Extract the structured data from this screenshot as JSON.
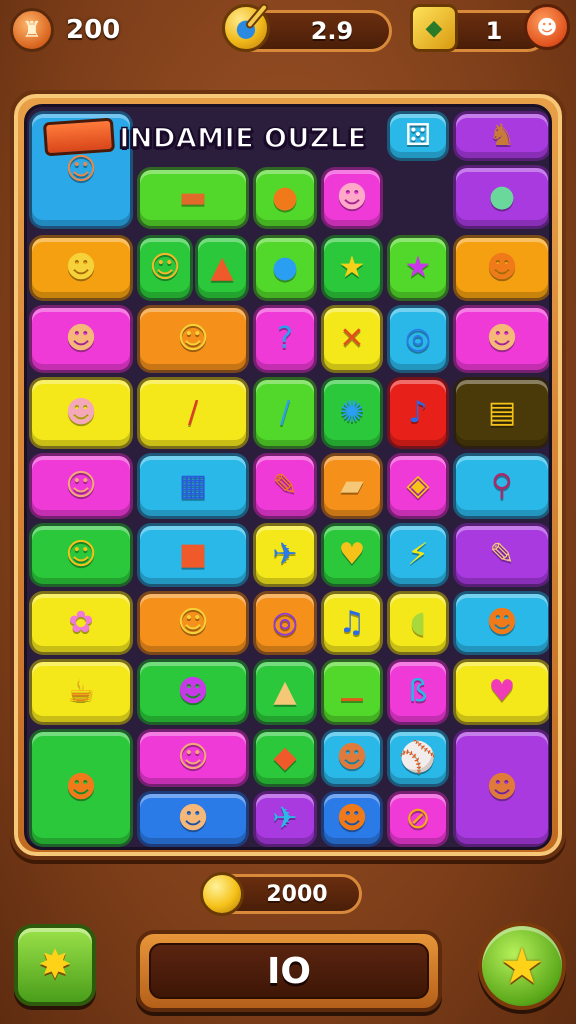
{
  "hud": {
    "left_count": "200",
    "mid_value": "2.9",
    "right_count": "1",
    "icons": {
      "left": "character-icon",
      "mid": "ball-icon",
      "right_square": "cheese-block-icon",
      "right_monster": "monster-icon"
    }
  },
  "board": {
    "title": "INDAMIE OUZLE",
    "tiles": [
      {
        "name": "tile-cat-face",
        "glyph": "☺",
        "color": "#2aa8e8",
        "fg": "#e8894a"
      },
      {
        "name": "tile-wood-bench",
        "glyph": "▬",
        "color": "#52d82a",
        "fg": "#e06a2a"
      },
      {
        "name": "tile-orange-ball",
        "glyph": "●",
        "color": "#52d82a",
        "fg": "#f07a1a"
      },
      {
        "name": "tile-pig",
        "glyph": "☻",
        "color": "#f03ad8",
        "fg": "#ffa8c8"
      },
      {
        "name": "tile-dice",
        "glyph": "⚄",
        "color": "#2ab8e8",
        "fg": "#ffffff"
      },
      {
        "name": "tile-moose",
        "glyph": "♞",
        "color": "#a83ae0",
        "fg": "#c87a3a"
      },
      {
        "name": "tile-turtle",
        "glyph": "●",
        "color": "#a83ae0",
        "fg": "#6ad89a"
      },
      {
        "name": "tile-orange-cat",
        "glyph": "☻",
        "color": "#f5a010",
        "fg": "#f5d23a"
      },
      {
        "name": "tile-chick",
        "glyph": "☺",
        "color": "#2ac83a",
        "fg": "#f5b82a"
      },
      {
        "name": "tile-cone",
        "glyph": "▲",
        "color": "#2ac83a",
        "fg": "#f05a2a"
      },
      {
        "name": "tile-blue-ball",
        "glyph": "●",
        "color": "#52d82a",
        "fg": "#2a9ef0"
      },
      {
        "name": "tile-star",
        "glyph": "★",
        "color": "#2ac83a",
        "fg": "#f5d21a"
      },
      {
        "name": "tile-purple-star",
        "glyph": "★",
        "color": "#52d82a",
        "fg": "#c83ae8"
      },
      {
        "name": "tile-fox",
        "glyph": "☻",
        "color": "#f5a010",
        "fg": "#f07a1a"
      },
      {
        "name": "tile-hamster",
        "glyph": "☻",
        "color": "#f03ad8",
        "fg": "#f5b878"
      },
      {
        "name": "tile-long-cat",
        "glyph": "☺",
        "color": "#f5901a",
        "fg": "#f5d23a"
      },
      {
        "name": "tile-question",
        "glyph": "?",
        "color": "#f03ad8",
        "fg": "#2a9ef0"
      },
      {
        "name": "tile-chopsticks",
        "glyph": "✕",
        "color": "#f5e81a",
        "fg": "#e0501a"
      },
      {
        "name": "tile-swirl",
        "glyph": "◎",
        "color": "#2ab8e8",
        "fg": "#2a7ae8"
      },
      {
        "name": "tile-pink-cat",
        "glyph": "☻",
        "color": "#f03ad8",
        "fg": "#f5b878"
      },
      {
        "name": "tile-pink-face",
        "glyph": "☻",
        "color": "#f5e81a",
        "fg": "#f5a8b8"
      },
      {
        "name": "tile-rolling-pin",
        "glyph": "/",
        "color": "#f5e81a",
        "fg": "#e03a2a"
      },
      {
        "name": "tile-blue-stick",
        "glyph": "/",
        "color": "#52d82a",
        "fg": "#2a9ef0"
      },
      {
        "name": "tile-germ",
        "glyph": "✺",
        "color": "#2ac83a",
        "fg": "#2a9ef0"
      },
      {
        "name": "tile-music-note",
        "glyph": "♪",
        "color": "#e8201a",
        "fg": "#2a6ae8"
      },
      {
        "name": "tile-ticket",
        "glyph": "▤",
        "color": "#4a3a0a",
        "fg": "#f5c21a"
      },
      {
        "name": "tile-crowned-face",
        "glyph": "☺",
        "color": "#f03ad8",
        "fg": "#f5a878"
      },
      {
        "name": "tile-calendar",
        "glyph": "▦",
        "color": "#2ab8e8",
        "fg": "#2a5ad8"
      },
      {
        "name": "tile-pencil",
        "glyph": "✎",
        "color": "#f03ad8",
        "fg": "#f07a1a"
      },
      {
        "name": "tile-bandage",
        "glyph": "▰",
        "color": "#f5901a",
        "fg": "#f5c878"
      },
      {
        "name": "tile-bottle",
        "glyph": "◈",
        "color": "#f03ad8",
        "fg": "#f5c21a"
      },
      {
        "name": "tile-yoyo",
        "glyph": "⚲",
        "color": "#2ab8e8",
        "fg": "#a82a6a"
      },
      {
        "name": "tile-smile",
        "glyph": "☺",
        "color": "#2ac83a",
        "fg": "#f5c21a"
      },
      {
        "name": "tile-red-box",
        "glyph": "■",
        "color": "#2ab8e8",
        "fg": "#f05a2a"
      },
      {
        "name": "tile-blue-plane",
        "glyph": "✈",
        "color": "#f5e81a",
        "fg": "#2a7ae8"
      },
      {
        "name": "tile-heart-face",
        "glyph": "♥",
        "color": "#2ac83a",
        "fg": "#f5c21a"
      },
      {
        "name": "tile-bolt",
        "glyph": "⚡",
        "color": "#2ab8e8",
        "fg": "#f5e81a"
      },
      {
        "name": "tile-syringe",
        "glyph": "✎",
        "color": "#a83ae0",
        "fg": "#f5c878"
      },
      {
        "name": "tile-cotton-candy",
        "glyph": "✿",
        "color": "#f5e81a",
        "fg": "#f07ad8"
      },
      {
        "name": "tile-cheese-cat",
        "glyph": "☺",
        "color": "#f5901a",
        "fg": "#f5d23a"
      },
      {
        "name": "tile-purple-swirl",
        "glyph": "◎",
        "color": "#f5901a",
        "fg": "#8a3ae0"
      },
      {
        "name": "tile-blue-note",
        "glyph": "♫",
        "color": "#f5e81a",
        "fg": "#2a6ae8"
      },
      {
        "name": "tile-leaf",
        "glyph": "◖",
        "color": "#f5e81a",
        "fg": "#a8d83a"
      },
      {
        "name": "tile-crab",
        "glyph": "☻",
        "color": "#2ab8e8",
        "fg": "#f07a1a"
      },
      {
        "name": "tile-teapot",
        "glyph": "☕",
        "color": "#f5e81a",
        "fg": "#f07a1a"
      },
      {
        "name": "tile-purple-blob",
        "glyph": "☻",
        "color": "#2ac83a",
        "fg": "#c83ae8"
      },
      {
        "name": "tile-tip-cone",
        "glyph": "▲",
        "color": "#2ac83a",
        "fg": "#f5c878"
      },
      {
        "name": "tile-bone",
        "glyph": "⚊",
        "color": "#52d82a",
        "fg": "#e05a1a"
      },
      {
        "name": "tile-blue-pretzel",
        "glyph": "ß",
        "color": "#f03ad8",
        "fg": "#2ab8e8"
      },
      {
        "name": "tile-heart",
        "glyph": "♥",
        "color": "#f5e81a",
        "fg": "#f03ab8"
      },
      {
        "name": "tile-dog",
        "glyph": "☻",
        "color": "#2ac83a",
        "fg": "#f07a1a"
      },
      {
        "name": "tile-king-face",
        "glyph": "☺",
        "color": "#f03ad8",
        "fg": "#f5a878"
      },
      {
        "name": "tile-fish",
        "glyph": "◆",
        "color": "#2ac83a",
        "fg": "#f05a2a"
      },
      {
        "name": "tile-monkey",
        "glyph": "☻",
        "color": "#2ab8e8",
        "fg": "#e07a3a"
      },
      {
        "name": "tile-baseball",
        "glyph": "⚾",
        "color": "#2ab8e8",
        "fg": "#ffffff"
      },
      {
        "name": "tile-brown-cat",
        "glyph": "☻",
        "color": "#a83ae0",
        "fg": "#e07a3a"
      },
      {
        "name": "tile-hippo",
        "glyph": "☻",
        "color": "#2a7ae8",
        "fg": "#f5b878"
      },
      {
        "name": "tile-blue-plane-2",
        "glyph": "✈",
        "color": "#a83ae0",
        "fg": "#2ab8e8"
      },
      {
        "name": "tile-fox-2",
        "glyph": "☻",
        "color": "#2a7ae8",
        "fg": "#f07a1a"
      },
      {
        "name": "tile-peach",
        "glyph": "⊘",
        "color": "#f03ad8",
        "fg": "#f5a81a"
      },
      {
        "name": "tile-ring",
        "glyph": "◉",
        "color": "#2a7ae8",
        "fg": "#ffffff"
      }
    ]
  },
  "footer": {
    "coins": "2000",
    "score": "IO",
    "left_button_icon": "sun-badge-icon",
    "right_button_icon": "star-icon"
  }
}
